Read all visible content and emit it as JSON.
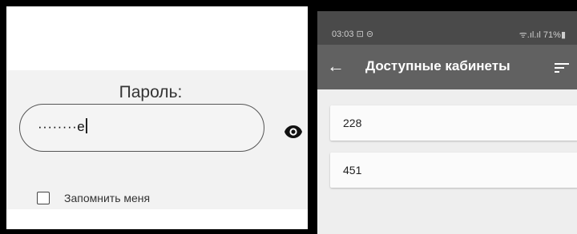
{
  "login": {
    "password_label": "Пароль:",
    "password_masked": "········",
    "password_last_char": "е",
    "remember_label": "Запомнить меня",
    "remember_checked": false
  },
  "phone": {
    "status_time": "03:03 ⊡ ⊝",
    "status_right": "ᯤ.ıl.ıl 71%▮",
    "back_glyph": "←",
    "title": "Доступные кабинеты",
    "rooms": [
      "228",
      "451"
    ]
  }
}
